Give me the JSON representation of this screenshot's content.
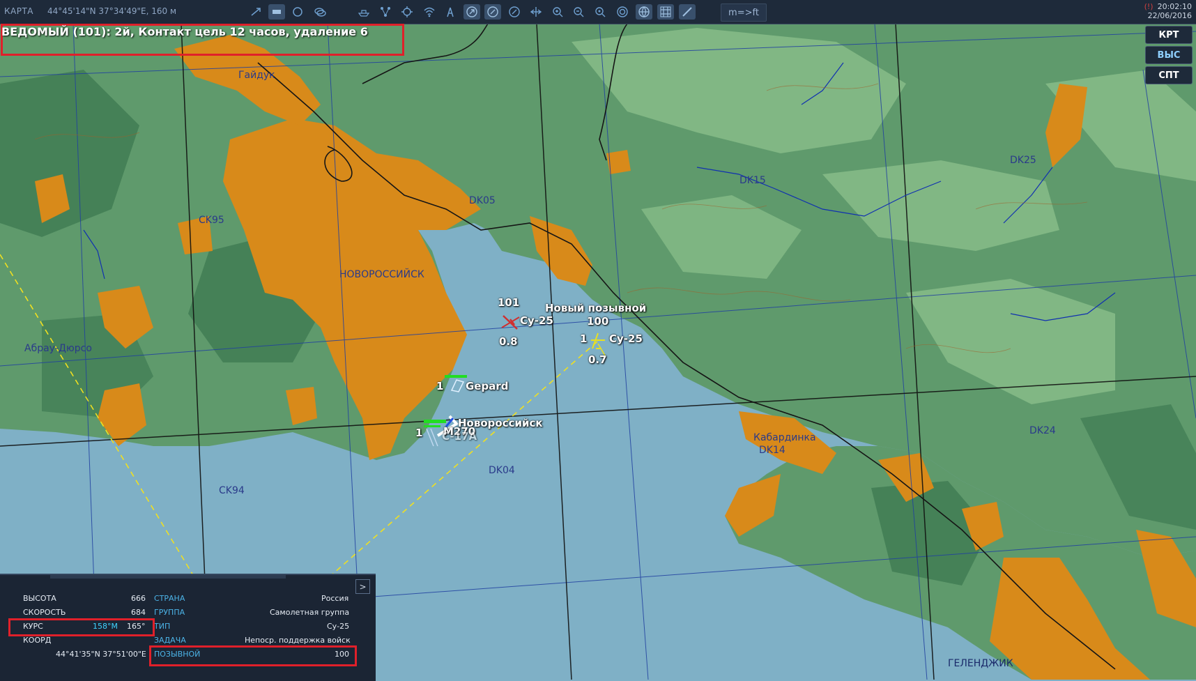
{
  "topbar": {
    "map_name": "КАРТА",
    "coords": "44°45'14\"N 37°34'49\"E, 160 м",
    "units_button": "m=>ft",
    "warn_indicator": "(!)",
    "time": "20:02:10",
    "date": "22/06/2016",
    "tools": [
      "flight-path-icon",
      "map-mode-icon",
      "circle-icon",
      "layers-icon",
      "ship-icon",
      "network-icon",
      "target-icon",
      "wifi-icon",
      "radio-tower-icon",
      "aircraft-filter-icon",
      "aircraft-filter-2-icon",
      "aircraft-filter-3-icon",
      "move-icon",
      "zoom-in-icon",
      "zoom-out-icon",
      "zoom-fit-icon",
      "radar-icon",
      "globe-icon",
      "grid-icon",
      "ruler-icon"
    ]
  },
  "message": "ВЕДОМЫЙ (101): 2й, Контакт  цель 12 часов, удаление 6",
  "right_buttons": [
    "КРТ",
    "ВЫС",
    "СПТ"
  ],
  "map": {
    "places": [
      "Гайдук",
      "DK05",
      "CK95",
      "НОВОРОССИЙСК",
      "Абрау-Дюрсо",
      "DK15",
      "DK25",
      "DK04",
      "CK94",
      "Кабардинка",
      "DK14",
      "DK24",
      "ГЕЛЕНДЖИК"
    ],
    "units": {
      "su25_a_num": "101",
      "su25_a_name": "Су-25",
      "su25_a_dist": "0.8",
      "su25_b_title": "Новый позывной",
      "su25_b_num": "100",
      "su25_b_count": "1",
      "su25_b_name": "Су-25",
      "su25_b_dist": "0.7",
      "gepard_count": "1",
      "gepard_name": "Gepard",
      "novo_name": "Новороссийск",
      "m270_count": "1",
      "m270_name": "M270",
      "c17_name": "C-17A"
    },
    "colors": {
      "sea": "#7fb0c6",
      "land": "#5f9a6c",
      "city": "#d88a1a",
      "dark_forest": "#3f7a52",
      "light_land": "#8cc08c"
    }
  },
  "info_panel": {
    "collapse_label": ">",
    "altitude_label": "ВЫСОТА",
    "altitude_value": "666",
    "speed_label": "СКОРОСТЬ",
    "speed_value": "684",
    "heading_label": "КУРС",
    "heading_mag": "158°M",
    "heading_true": "165°",
    "coord_label": "КООРД",
    "coord_value": "44°41'35\"N 37°51'00\"E",
    "country_label": "СТРАНА",
    "country_value": "Россия",
    "group_label": "ГРУППА",
    "group_value": "Самолетная группа",
    "type_label": "ТИП",
    "type_value": "Су-25",
    "task_label": "ЗАДАЧА",
    "task_value": "Непоср. поддержка войск",
    "callsign_label": "ПОЗЫВНОЙ",
    "callsign_value": "100"
  }
}
